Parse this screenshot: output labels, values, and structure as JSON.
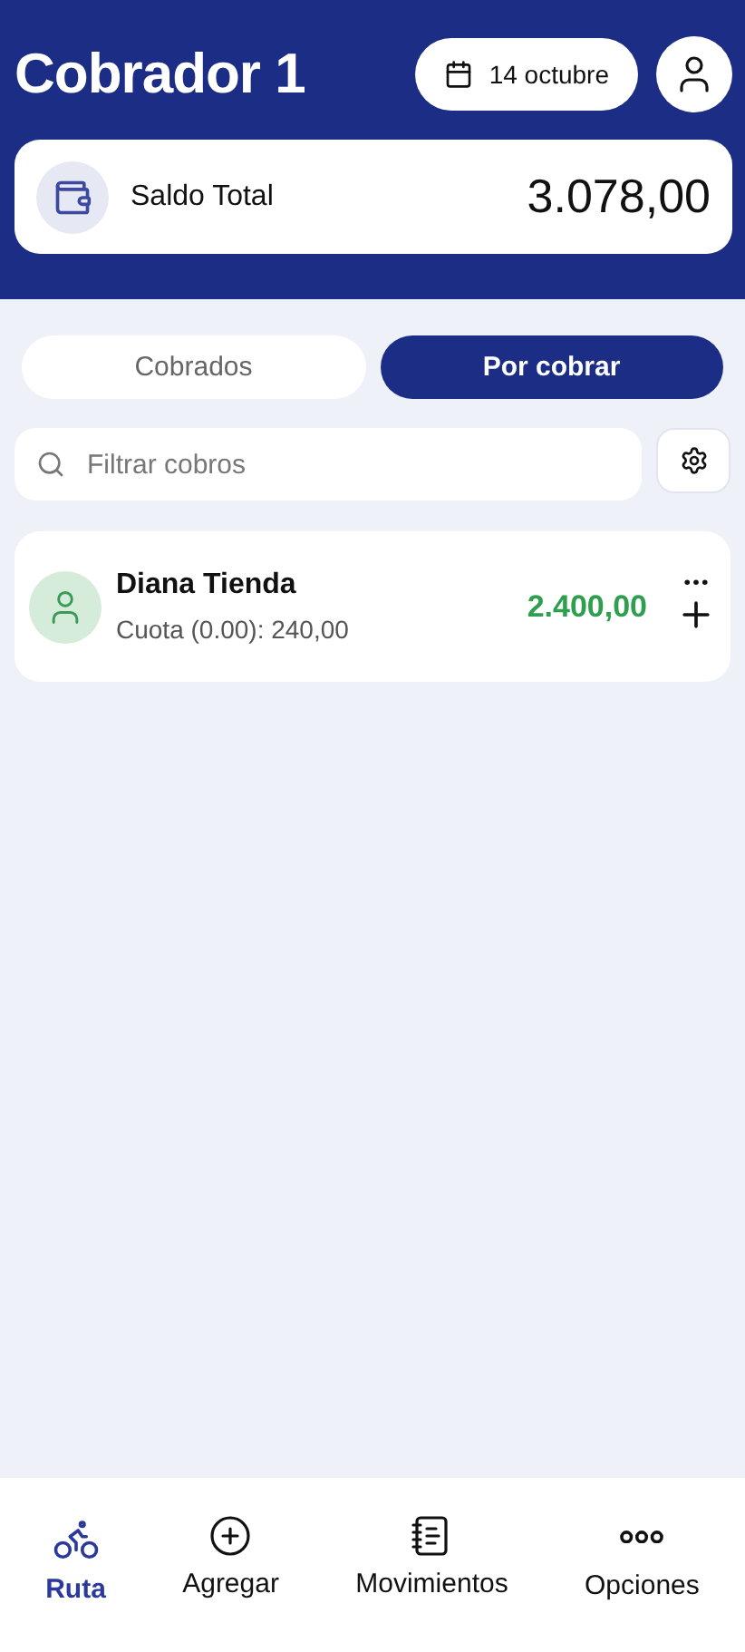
{
  "header": {
    "title": "Cobrador 1",
    "date": "14 octubre"
  },
  "balance": {
    "label": "Saldo Total",
    "amount": "3.078,00"
  },
  "tabs": [
    {
      "label": "Cobrados",
      "selected": false
    },
    {
      "label": "Por cobrar",
      "selected": true
    }
  ],
  "search": {
    "placeholder": "Filtrar cobros"
  },
  "clients": [
    {
      "name": "Diana Tienda",
      "detail": "Cuota (0.00): 240,00",
      "amount": "2.400,00"
    }
  ],
  "nav": [
    {
      "label": "Ruta",
      "selected": true
    },
    {
      "label": "Agregar",
      "selected": false
    },
    {
      "label": "Movimientos",
      "selected": false
    },
    {
      "label": "Opciones",
      "selected": false
    }
  ]
}
